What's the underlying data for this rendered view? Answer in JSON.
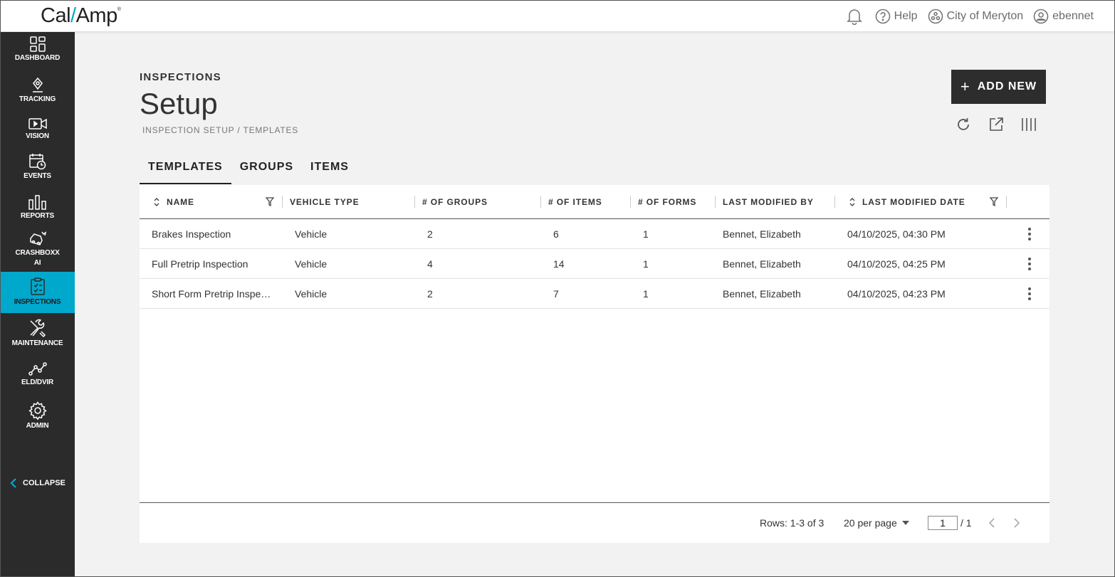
{
  "app": {
    "logo_left": "Cal",
    "logo_slash": "/",
    "logo_right": "Amp",
    "logo_mark": "®"
  },
  "topbar": {
    "help_label": "Help",
    "org_label": "City of Meryton",
    "user_label": "ebennet"
  },
  "sidebar": {
    "items": [
      {
        "label": "DASHBOARD",
        "icon": "dashboard-icon"
      },
      {
        "label": "TRACKING",
        "icon": "location-pin-icon"
      },
      {
        "label": "VISION",
        "icon": "video-camera-icon"
      },
      {
        "label": "EVENTS",
        "icon": "calendar-clock-icon"
      },
      {
        "label": "REPORTS",
        "icon": "bar-chart-icon"
      },
      {
        "label": "CRASHBOXX",
        "label2": "AI",
        "icon": "crash-car-icon"
      },
      {
        "label": "INSPECTIONS",
        "icon": "clipboard-check-icon",
        "active": true
      },
      {
        "label": "MAINTENANCE",
        "icon": "wrench-screwdriver-icon"
      },
      {
        "label": "ELD/DVIR",
        "icon": "route-icon"
      },
      {
        "label": "ADMIN",
        "icon": "gear-icon"
      }
    ],
    "collapse_label": "COLLAPSE"
  },
  "page": {
    "section": "INSPECTIONS",
    "title": "Setup",
    "breadcrumb": "INSPECTION SETUP / TEMPLATES",
    "add_button": "ADD NEW",
    "add_icon": "+"
  },
  "tabs": [
    "TEMPLATES",
    "GROUPS",
    "ITEMS"
  ],
  "table": {
    "columns": [
      "NAME",
      "VEHICLE TYPE",
      "# OF GROUPS",
      "# OF ITEMS",
      "# OF FORMS",
      "LAST MODIFIED BY",
      "LAST MODIFIED DATE"
    ],
    "rows": [
      {
        "name": "Brakes Inspection",
        "vehicle_type": "Vehicle",
        "groups": "2",
        "items": "6",
        "forms": "1",
        "modified_by": "Bennet, Elizabeth",
        "modified_date": "04/10/2025, 04:30 PM"
      },
      {
        "name": "Full Pretrip Inspection",
        "vehicle_type": "Vehicle",
        "groups": "4",
        "items": "14",
        "forms": "1",
        "modified_by": "Bennet, Elizabeth",
        "modified_date": "04/10/2025, 04:25 PM"
      },
      {
        "name": "Short Form Pretrip Inspe…",
        "vehicle_type": "Vehicle",
        "groups": "2",
        "items": "7",
        "forms": "1",
        "modified_by": "Bennet, Elizabeth",
        "modified_date": "04/10/2025, 04:23 PM"
      }
    ]
  },
  "footer": {
    "rows_info": "Rows: 1-3 of 3",
    "per_page": "20 per page",
    "current_page": "1",
    "total_pages": "/ 1"
  },
  "colors": {
    "accent": "#00a8cc",
    "sidebar": "#2b2b2b",
    "button": "#2d2d2d"
  }
}
